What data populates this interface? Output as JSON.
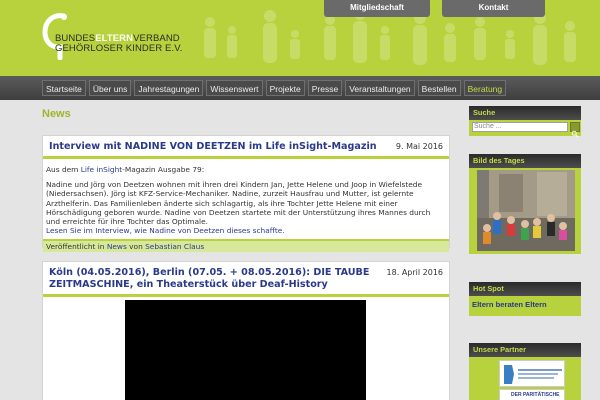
{
  "header": {
    "logo_line1_pre": "BUNDES",
    "logo_line1_bold": "ELTERN",
    "logo_line1_post": "VERBAND",
    "logo_line2": "GEHÖRLOSER KINDER E.V.",
    "top_buttons": [
      "Mitgliedschaft",
      "Kontakt"
    ]
  },
  "nav": {
    "items": [
      {
        "label": "Startseite"
      },
      {
        "label": "Über uns"
      },
      {
        "label": "Jahrestagungen"
      },
      {
        "label": "Wissenswert"
      },
      {
        "label": "Projekte"
      },
      {
        "label": "Presse"
      },
      {
        "label": "Veranstaltungen"
      },
      {
        "label": "Bestellen"
      },
      {
        "label": "Beratung"
      }
    ]
  },
  "main": {
    "heading": "News",
    "articles": [
      {
        "title": "Interview mit NADINE VON DEETZEN im Life inSight-Magazin",
        "date": "9. Mai 2016",
        "intro_pre": "Aus dem ",
        "intro_link": "Life inSight",
        "intro_post": "-Magazin Ausgabe 79:",
        "body": "Nadine und Jörg von Deetzen wohnen mit ihren drei Kindern Jan, Jette Helene und Joop in Wiefelstede (Niedersachsen). Jörg ist KFZ-Service-Mechaniker. Nadine, zurzeit Hausfrau und Mutter, ist gelernte Arzthelferin. Das Familienleben änderte sich schlagartig, als ihre Tochter Jette Helene mit einer Hörschädigung geboren wurde. Nadine von Deetzen startete mit der Unterstützung ihres Mannes durch und erreichte für ihre Tochter das Optimale.",
        "read_more": "Lesen Sie im Interview, wie Nadine von Deetzen dieses schaffte.",
        "footer_pre": "Veröffentlicht in ",
        "footer_cat": "News",
        "footer_mid": " von ",
        "footer_author": "Sebastian Claus"
      },
      {
        "title": "Köln (04.05.2016), Berlin (07.05. + 08.05.2016): DIE TAUBE ZEITMASCHINE, ein Theaterstück über Deaf-History",
        "date": "18. April 2016"
      }
    ]
  },
  "sidebar": {
    "search_title": "Suche",
    "search_placeholder": "Suche ...",
    "photo_title": "Bild des Tages",
    "hotspot_title": "Hot Spot",
    "hotspot_link": "Eltern beraten Eltern",
    "partner_title": "Unsere Partner",
    "partner_2": "DER PARITÄTISCHE"
  },
  "colors": {
    "accent": "#b7d23c",
    "nav_bg": "#4a4a4a",
    "link": "#2a3a8a"
  }
}
